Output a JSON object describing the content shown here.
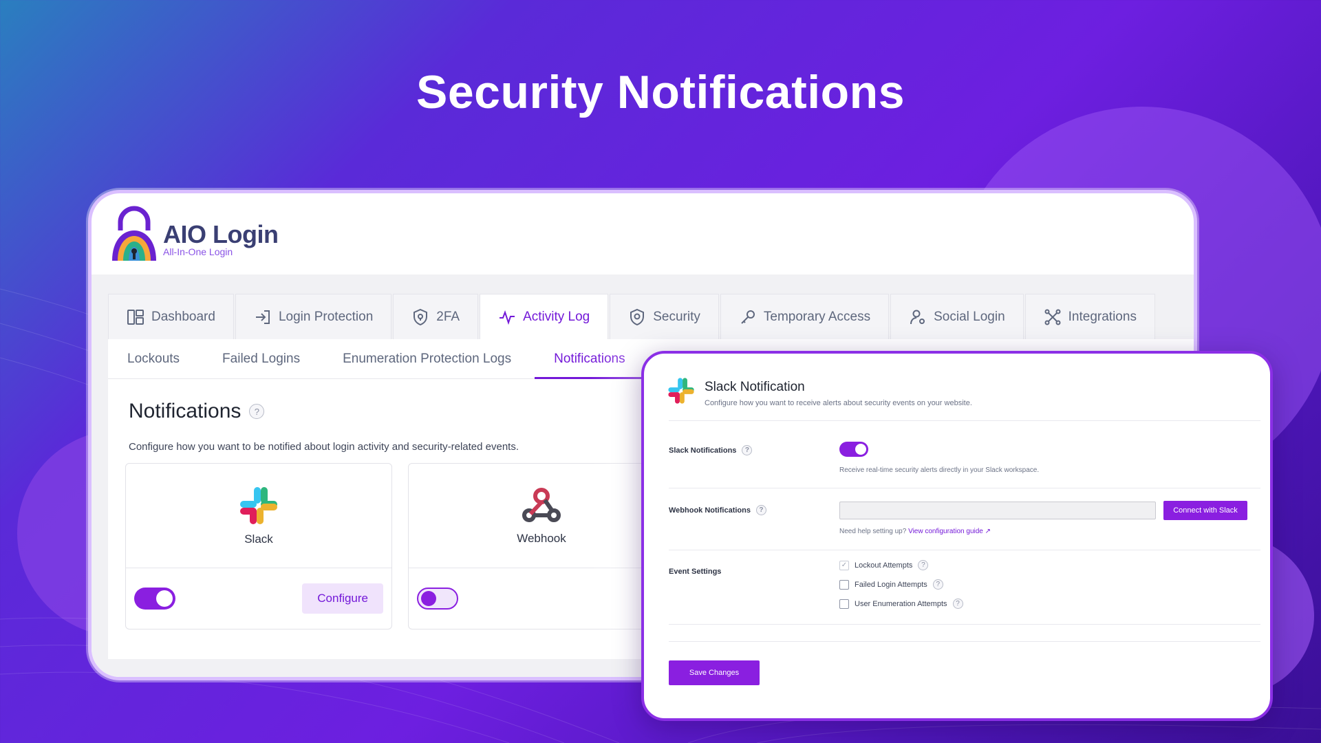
{
  "page": {
    "title": "Security Notifications"
  },
  "brand": {
    "name": "AIO Login",
    "tagline": "All-In-One Login"
  },
  "tabs": [
    {
      "label": "Dashboard",
      "icon": "dashboard-icon",
      "active": false
    },
    {
      "label": "Login Protection",
      "icon": "login-arrow-icon",
      "active": false
    },
    {
      "label": "2FA",
      "icon": "shield-lock-icon",
      "active": false
    },
    {
      "label": "Activity Log",
      "icon": "activity-pulse-icon",
      "active": true
    },
    {
      "label": "Security",
      "icon": "shield-icon",
      "active": false
    },
    {
      "label": "Temporary Access",
      "icon": "key-icon",
      "active": false
    },
    {
      "label": "Social Login",
      "icon": "user-settings-icon",
      "active": false
    },
    {
      "label": "Integrations",
      "icon": "integrations-icon",
      "active": false
    }
  ],
  "subtabs": [
    {
      "label": "Lockouts",
      "active": false
    },
    {
      "label": "Failed Logins",
      "active": false
    },
    {
      "label": "Enumeration Protection Logs",
      "active": false
    },
    {
      "label": "Notifications",
      "active": true
    }
  ],
  "notifications": {
    "title": "Notifications",
    "help": "?",
    "description": "Configure how you want to be notified about login activity and security-related events.",
    "cards": [
      {
        "name": "Slack",
        "icon": "slack-icon",
        "enabled": true,
        "button": "Configure"
      },
      {
        "name": "Webhook",
        "icon": "webhook-icon",
        "enabled": false
      }
    ]
  },
  "slack_panel": {
    "title": "Slack Notification",
    "subtitle": "Configure how you want to receive alerts about security events on your website.",
    "slack_label": "Slack Notifications",
    "slack_enabled": true,
    "slack_note": "Receive real-time security alerts directly in your Slack workspace.",
    "webhook_label": "Webhook Notifications",
    "webhook_value": "",
    "connect_label": "Connect with Slack",
    "help_text": "Need help setting up?",
    "help_link": "View configuration guide",
    "link_arrow": "↗",
    "events_label": "Event Settings",
    "events": [
      {
        "label": "Lockout Attempts",
        "checked": true
      },
      {
        "label": "Failed Login Attempts",
        "checked": false
      },
      {
        "label": "User Enumeration Attempts",
        "checked": false
      }
    ],
    "save_label": "Save Changes"
  },
  "colors": {
    "accent": "#8a1fe0",
    "accent_dark": "#7318d8",
    "text": "#1f2430",
    "muted": "#5e677d"
  }
}
